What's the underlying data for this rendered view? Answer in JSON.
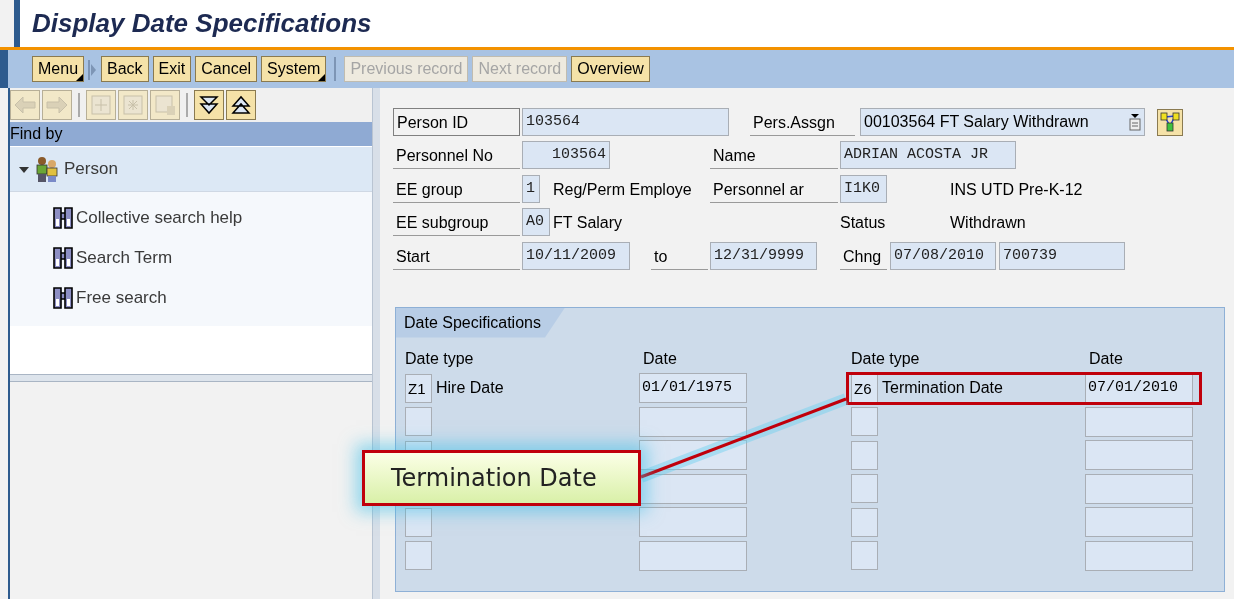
{
  "window": {
    "title": "Display Date Specifications"
  },
  "toolbar": [
    {
      "label": "Menu",
      "kind": "menu",
      "disabled": false
    },
    {
      "label": "Back",
      "kind": "button",
      "disabled": false
    },
    {
      "label": "Exit",
      "kind": "button",
      "disabled": false
    },
    {
      "label": "Cancel",
      "kind": "button",
      "disabled": false
    },
    {
      "label": "System",
      "kind": "menu",
      "disabled": false
    },
    {
      "label": "Previous record",
      "kind": "button",
      "disabled": true
    },
    {
      "label": "Next record",
      "kind": "button",
      "disabled": true
    },
    {
      "label": "Overview",
      "kind": "button",
      "disabled": false
    }
  ],
  "sidebar": {
    "header": "Find by",
    "items": [
      {
        "label": "Person",
        "expanded": true,
        "children": [
          {
            "label": "Collective search help"
          },
          {
            "label": "Search Term"
          },
          {
            "label": "Free search"
          }
        ]
      }
    ]
  },
  "header_rows": [
    [
      {
        "kind": "boxlabel",
        "text": "Person ID"
      },
      {
        "kind": "field",
        "text": "103564"
      },
      {
        "kind": "label",
        "text": "Pers.Assgn"
      },
      {
        "kind": "dropdown",
        "text": "00103564 FT Salary Withdrawn"
      },
      {
        "kind": "iconbutton"
      }
    ],
    [
      {
        "kind": "label",
        "text": "Personnel No"
      },
      {
        "kind": "field",
        "text": "103564",
        "right_aligned": true
      },
      {
        "kind": "label",
        "text": "Name"
      },
      {
        "kind": "field",
        "text": "ADRIAN ACOSTA JR"
      }
    ],
    [
      {
        "kind": "label",
        "text": "EE group"
      },
      {
        "kind": "field",
        "text": "1"
      },
      {
        "kind": "text",
        "text": "Reg/Perm Employe"
      },
      {
        "kind": "label",
        "text": "Personnel ar"
      },
      {
        "kind": "field",
        "text": "I1K0"
      },
      {
        "kind": "text",
        "text": "INS UTD Pre-K-12"
      }
    ],
    [
      {
        "kind": "label",
        "text": "EE subgroup"
      },
      {
        "kind": "field",
        "text": "A0"
      },
      {
        "kind": "text",
        "text": "FT Salary"
      },
      {
        "kind": "text",
        "text": "Status"
      },
      {
        "kind": "text",
        "text": "Withdrawn"
      }
    ],
    [
      {
        "kind": "label",
        "text": "Start"
      },
      {
        "kind": "field",
        "text": "10/11/2009"
      },
      {
        "kind": "label",
        "text": "to"
      },
      {
        "kind": "field",
        "text": "12/31/9999"
      },
      {
        "kind": "label",
        "text": "Chng"
      },
      {
        "kind": "field",
        "text": "07/08/2010"
      },
      {
        "kind": "field",
        "text": "700739"
      }
    ]
  ],
  "date_specifications": {
    "title": "Date Specifications",
    "columns": [
      {
        "type_heading": "Date type",
        "date_heading": "Date",
        "rows": [
          {
            "kind": "filled",
            "code": "Z1",
            "text": "Hire Date",
            "date": "01/01/1975",
            "highlighted": false
          },
          {
            "kind": "empty"
          },
          {
            "kind": "empty"
          },
          {
            "kind": "covered"
          },
          {
            "kind": "empty"
          },
          {
            "kind": "empty"
          }
        ]
      },
      {
        "type_heading": "Date type",
        "date_heading": "Date",
        "rows": [
          {
            "kind": "filled",
            "code": "Z6",
            "text": "Termination Date",
            "date": "07/01/2010",
            "highlighted": true
          },
          {
            "kind": "empty"
          },
          {
            "kind": "empty"
          },
          {
            "kind": "empty"
          },
          {
            "kind": "empty"
          },
          {
            "kind": "empty"
          }
        ]
      }
    ]
  },
  "callout": {
    "text": "Termination Date"
  }
}
